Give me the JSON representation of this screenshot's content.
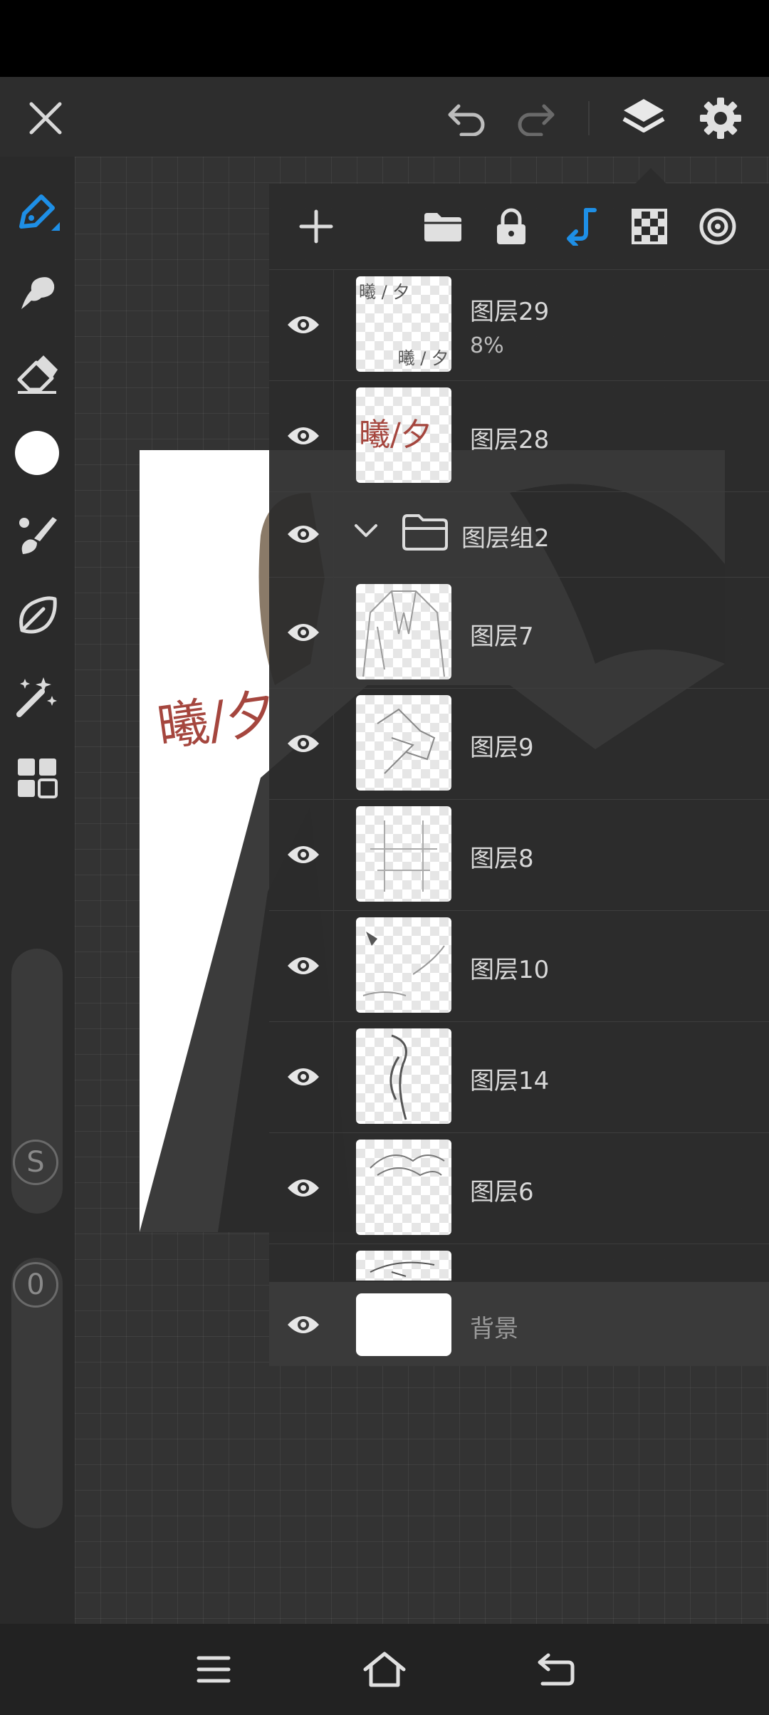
{
  "app": {
    "accent": "#1e8fe6"
  },
  "toolbar": {
    "close_icon": "close-icon",
    "undo_icon": "undo-icon",
    "redo_icon": "redo-icon",
    "layers_icon": "layers-icon",
    "settings_icon": "gear-icon"
  },
  "side_tools": {
    "items": [
      "pen",
      "smudge",
      "eraser",
      "color",
      "brush",
      "lasso",
      "magic-wand",
      "gallery"
    ],
    "size_badge": "S",
    "opacity_badge": "0"
  },
  "layers_panel": {
    "toolbar": [
      "add-layer",
      "new-folder",
      "lock",
      "clip",
      "transparency",
      "reference"
    ],
    "layers": [
      {
        "name": "图层29",
        "opacity": "8%",
        "thumb_text_top": "曦 / 夕",
        "thumb_text_bottom": "曦 / 夕"
      },
      {
        "name": "图层28",
        "thumb_text": "曦/夕"
      },
      {
        "name": "图层组2",
        "type": "group"
      },
      {
        "name": "图层7"
      },
      {
        "name": "图层9"
      },
      {
        "name": "图层8"
      },
      {
        "name": "图层10"
      },
      {
        "name": "图层14"
      },
      {
        "name": "图层6"
      }
    ],
    "background_label": "背景"
  },
  "artwork": {
    "signature_text": "曦/夕"
  }
}
